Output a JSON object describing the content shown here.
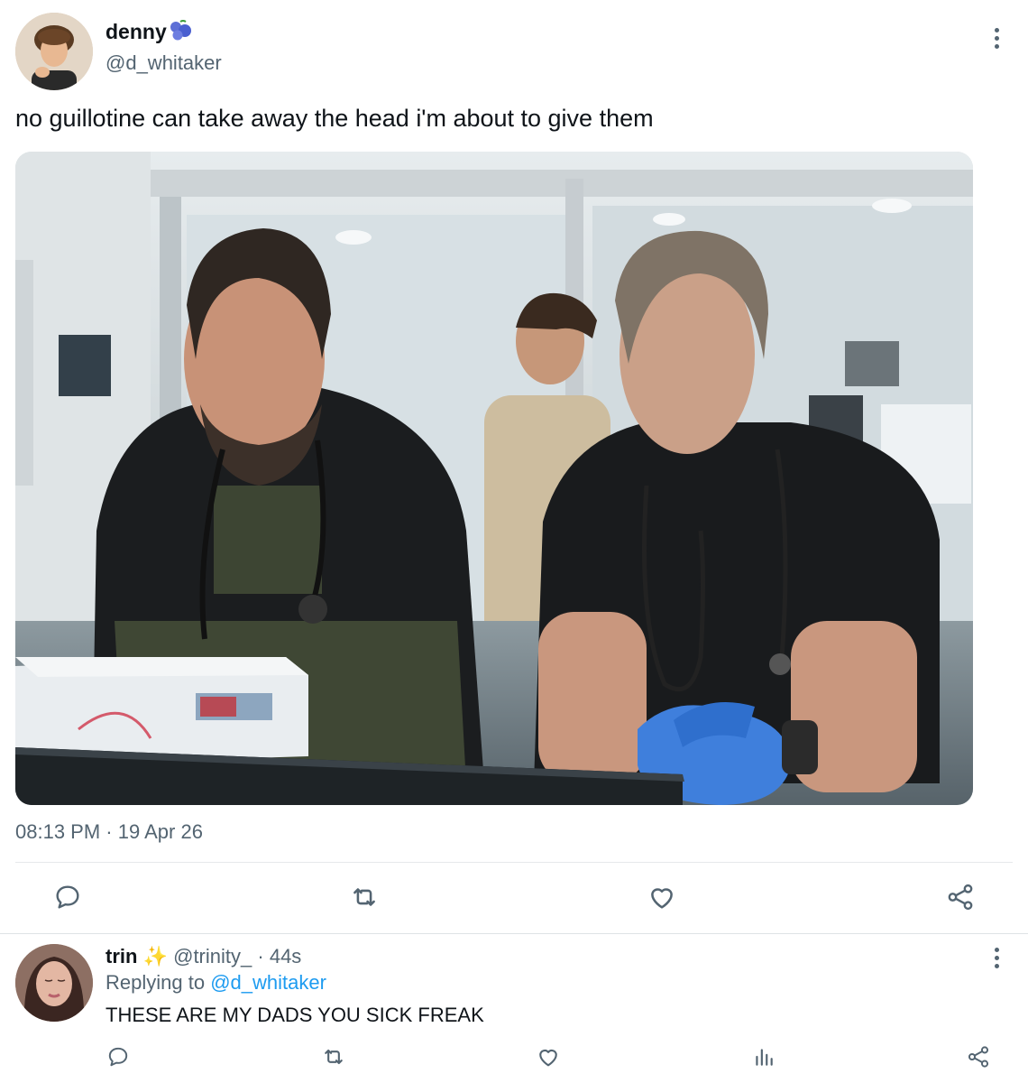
{
  "tweet": {
    "author_name": "denny",
    "author_handle": "@d_whitaker",
    "badge_icon": "blueberries-emoji-icon",
    "text": "no guillotine can take away the head i'm about to give them",
    "media_description_icon": "photo",
    "time": "08:13 PM",
    "separator": "·",
    "date": "19 Apr 26",
    "actions": [
      "reply-icon",
      "retweet-icon",
      "like-icon",
      "share-icon"
    ]
  },
  "reply": {
    "author_name": "trin",
    "badge": "✨",
    "author_handle": "@trinity_",
    "separator": "·",
    "age": "44s",
    "replying_prefix": "Replying to",
    "replying_to": "@d_whitaker",
    "text": "THESE ARE MY DADS YOU SICK FREAK",
    "actions": [
      "reply-icon",
      "retweet-icon",
      "like-icon",
      "analytics-icon",
      "share-icon"
    ]
  },
  "colors": {
    "text": "#0f1419",
    "muted": "#536471",
    "link": "#1d9bf0",
    "icon": "#536471",
    "badge_blue": "#4a5fd0"
  }
}
